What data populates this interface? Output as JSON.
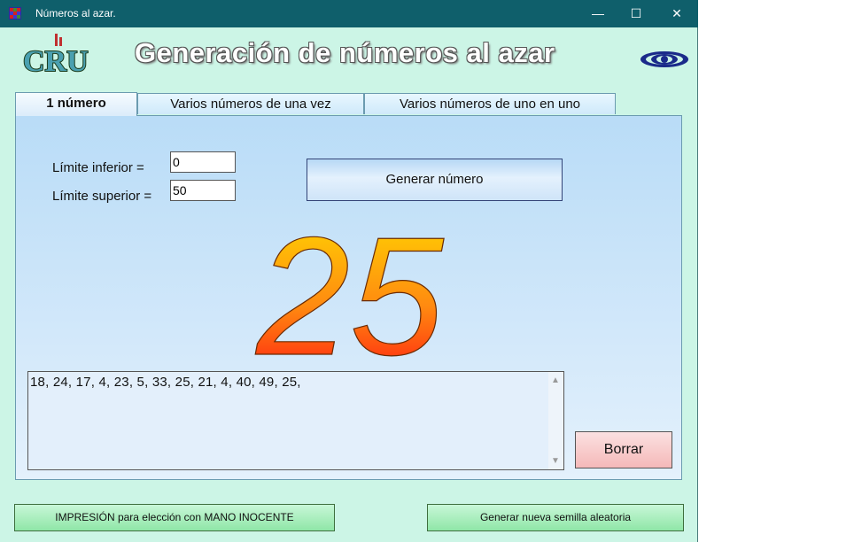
{
  "window": {
    "title": "Números al azar.",
    "minimize": "—",
    "maximize": "☐",
    "close": "✕"
  },
  "header": {
    "logo_text": "CRUZ",
    "title": "Generación de números al azar"
  },
  "tabs": [
    {
      "label": "1 número",
      "active": true
    },
    {
      "label": "Varios números de una vez",
      "active": false
    },
    {
      "label": "Varios números de uno en uno",
      "active": false
    }
  ],
  "form": {
    "lower_label": "Límite inferior =",
    "lower_value": "0",
    "upper_label": "Límite superior =",
    "upper_value": "50",
    "generate_label": "Generar número"
  },
  "result": {
    "number": "25"
  },
  "history": {
    "text": "18, 24, 17, 4, 23, 5, 33, 25, 21, 4, 40, 49, 25,"
  },
  "clear_label": "Borrar",
  "bottom": {
    "print_label": "IMPRESIÓN  para elección con  MANO INOCENTE",
    "seed_label": "Generar nueva semilla aleatoria"
  },
  "colors": {
    "titlebar": "#0f5f6b",
    "window_bg": "#ccf5e6",
    "number_gradient_top": "#ffd800",
    "number_gradient_bottom": "#ff1a1a"
  }
}
